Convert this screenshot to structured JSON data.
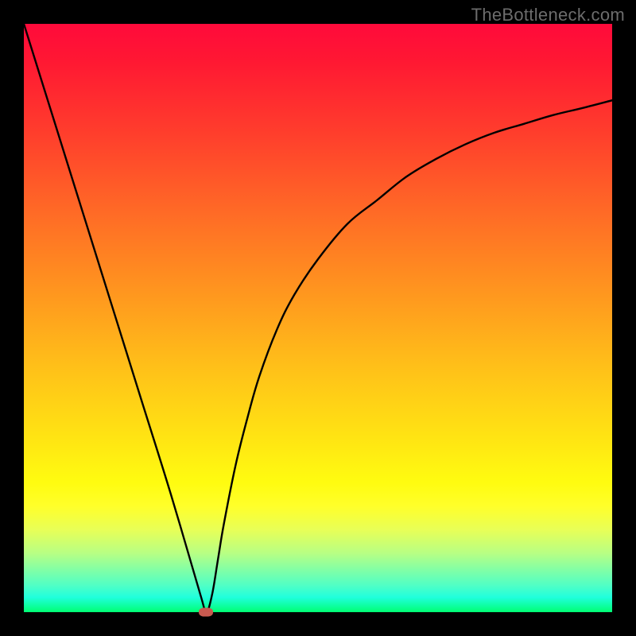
{
  "watermark": "TheBottleneck.com",
  "chart_data": {
    "type": "line",
    "title": "",
    "xlabel": "",
    "ylabel": "",
    "xlim": [
      0,
      100
    ],
    "ylim": [
      0,
      100
    ],
    "series": [
      {
        "name": "bottleneck-curve",
        "x": [
          0,
          5,
          10,
          15,
          20,
          25,
          30,
          31,
          32,
          33,
          34,
          36,
          38,
          40,
          43,
          46,
          50,
          55,
          60,
          65,
          70,
          75,
          80,
          85,
          90,
          95,
          100
        ],
        "y": [
          100,
          84,
          68,
          52,
          36,
          20,
          3,
          0,
          3,
          9,
          15,
          25,
          33,
          40,
          48,
          54,
          60,
          66,
          70,
          74,
          77,
          79.5,
          81.5,
          83,
          84.5,
          85.7,
          87
        ]
      }
    ],
    "annotations": [
      {
        "name": "minimum-marker",
        "x": 31,
        "y": 0
      }
    ],
    "background": "vertical-heat-gradient"
  }
}
